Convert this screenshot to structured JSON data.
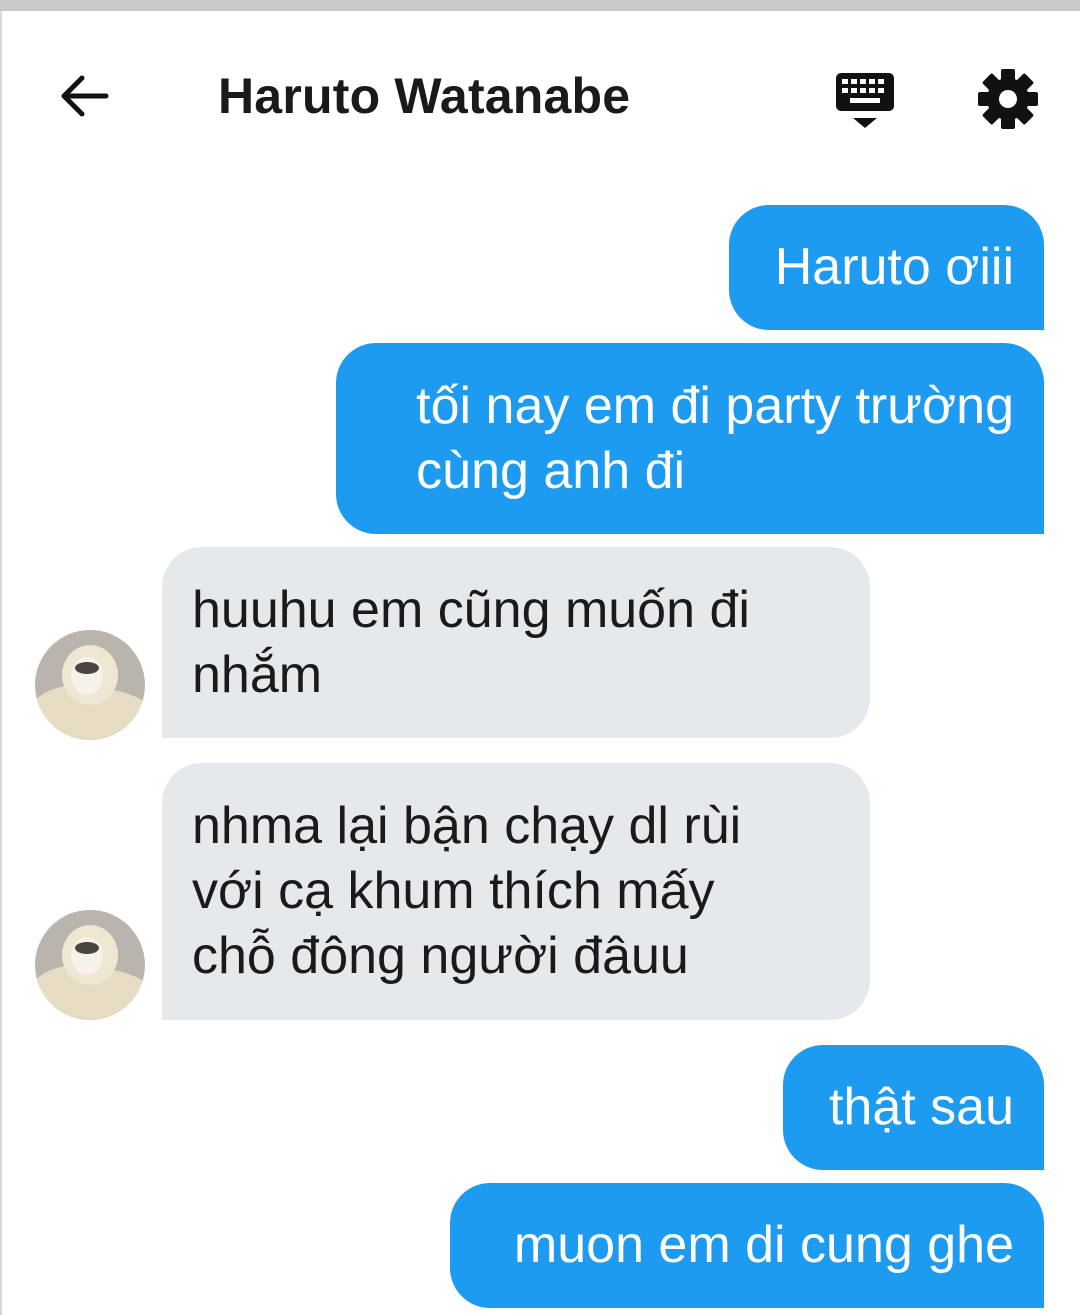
{
  "header": {
    "title": "Haruto Watanabe",
    "back_icon": "arrow-left-icon",
    "keyboard_icon": "keyboard-hide-icon",
    "settings_icon": "gear-icon"
  },
  "colors": {
    "outgoing_bubble": "#1d9bf0",
    "incoming_bubble": "#e6e9ec",
    "text_dark": "#1a1a1a"
  },
  "messages": [
    {
      "direction": "outgoing",
      "text": "Haruto ơiii"
    },
    {
      "direction": "outgoing",
      "text": "tối nay em đi party trường\ncùng anh đi"
    },
    {
      "direction": "incoming",
      "text": "huuhu em cũng muốn đi\nnhắm"
    },
    {
      "direction": "incoming",
      "text": "nhma lại bận chạy dl rùi\nvới cạ khum thích mấy\nchỗ đông người đâuu"
    },
    {
      "direction": "outgoing",
      "text": "thật sau"
    },
    {
      "direction": "outgoing",
      "text": "muon em di cung ghe"
    }
  ]
}
